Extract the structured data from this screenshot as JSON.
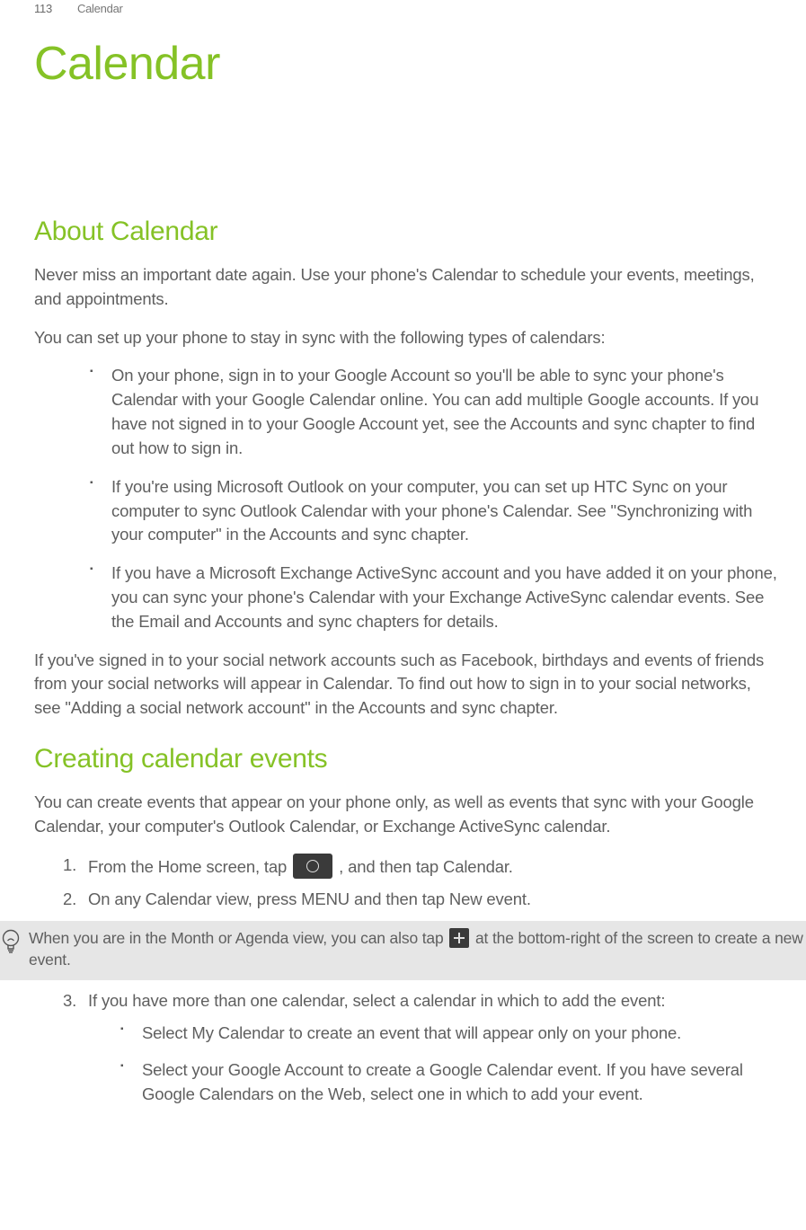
{
  "header": {
    "page_number": "113",
    "chapter": "Calendar"
  },
  "title": "Calendar",
  "section_about": {
    "heading": "About Calendar",
    "intro": "Never miss an important date again. Use your phone's Calendar to schedule your events, meetings, and appointments.",
    "sync_intro": "You can set up your phone to stay in sync with the following types of calendars:",
    "bullets": [
      "On your phone, sign in to your Google Account so you'll be able to sync your phone's Calendar with your Google Calendar online. You can add multiple Google accounts. If you have not signed in to your Google Account yet, see the Accounts and sync chapter to find out how to sign in.",
      "If you're using Microsoft Outlook on your computer, you can set up HTC Sync on your computer to sync Outlook Calendar with your phone's Calendar. See \"Synchronizing with your computer\" in the Accounts and sync chapter.",
      "If you have a Microsoft Exchange ActiveSync account and you have added it on your phone, you can sync your phone's Calendar with your Exchange ActiveSync calendar events. See the Email and Accounts and sync chapters for details."
    ],
    "social": "If you've signed in to your social network accounts such as Facebook, birthdays and events of friends from your social networks will appear in Calendar. To find out how to sign in to your social networks, see \"Adding a social network account\" in the Accounts and sync chapter."
  },
  "section_create": {
    "heading": "Creating calendar events",
    "intro": "You can create events that appear on your phone only, as well as events that sync with your Google Calendar, your computer's Outlook Calendar, or Exchange ActiveSync calendar.",
    "step1_pre": "From the Home screen, tap ",
    "step1_post": " , and then tap Calendar.",
    "step2": "On any Calendar view, press MENU and then tap New event.",
    "tip_pre": "When you are in the Month or Agenda view, you can also tap ",
    "tip_post": " at the bottom-right of the screen to create a new event.",
    "step3": "If you have more than one calendar, select a calendar in which to add the event:",
    "sub_bullets": [
      "Select My Calendar to create an event that will appear only on your phone.",
      "Select your Google Account to create a Google Calendar event. If you have several Google Calendars on the Web, select one in which to add your event."
    ]
  }
}
